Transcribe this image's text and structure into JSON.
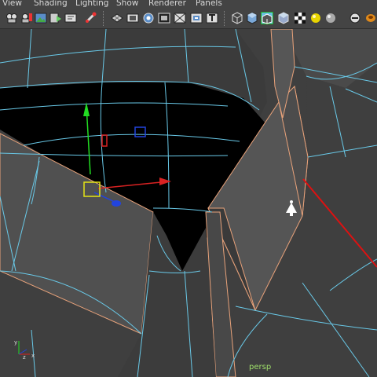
{
  "menu": {
    "view": "View",
    "shading": "Shading",
    "lighting": "Lighting",
    "show": "Show",
    "renderer": "Renderer",
    "panels": "Panels"
  },
  "toolbar_icons": [
    "camera-attributes-icon",
    "bookmark-camera-icon",
    "image-plane-icon",
    "two-d-pan-zoom-icon",
    "grease-pencil-icon",
    "grid-icon",
    "film-gate-icon",
    "resolution-gate-icon",
    "gate-mask-icon",
    "field-chart-icon",
    "safe-action-icon",
    "wireframe-icon",
    "smooth-shade-icon",
    "wireframe-on-shaded-icon",
    "xray-icon",
    "default-lighting-icon",
    "shadows-icon",
    "ambient-occlusion-icon",
    "isolate-select-icon"
  ],
  "viewport": {
    "camera_label": "persp",
    "axis_labels": {
      "x": "x",
      "y": "y",
      "z": "z"
    }
  },
  "colors": {
    "wire": "#69c9e8",
    "selection_edge": "#e8a27a",
    "manip_x": "#d92222",
    "manip_y": "#22dd22",
    "manip_z": "#2244dd",
    "manip_center": "#e5e515",
    "camera_label": "#9fe06a"
  }
}
